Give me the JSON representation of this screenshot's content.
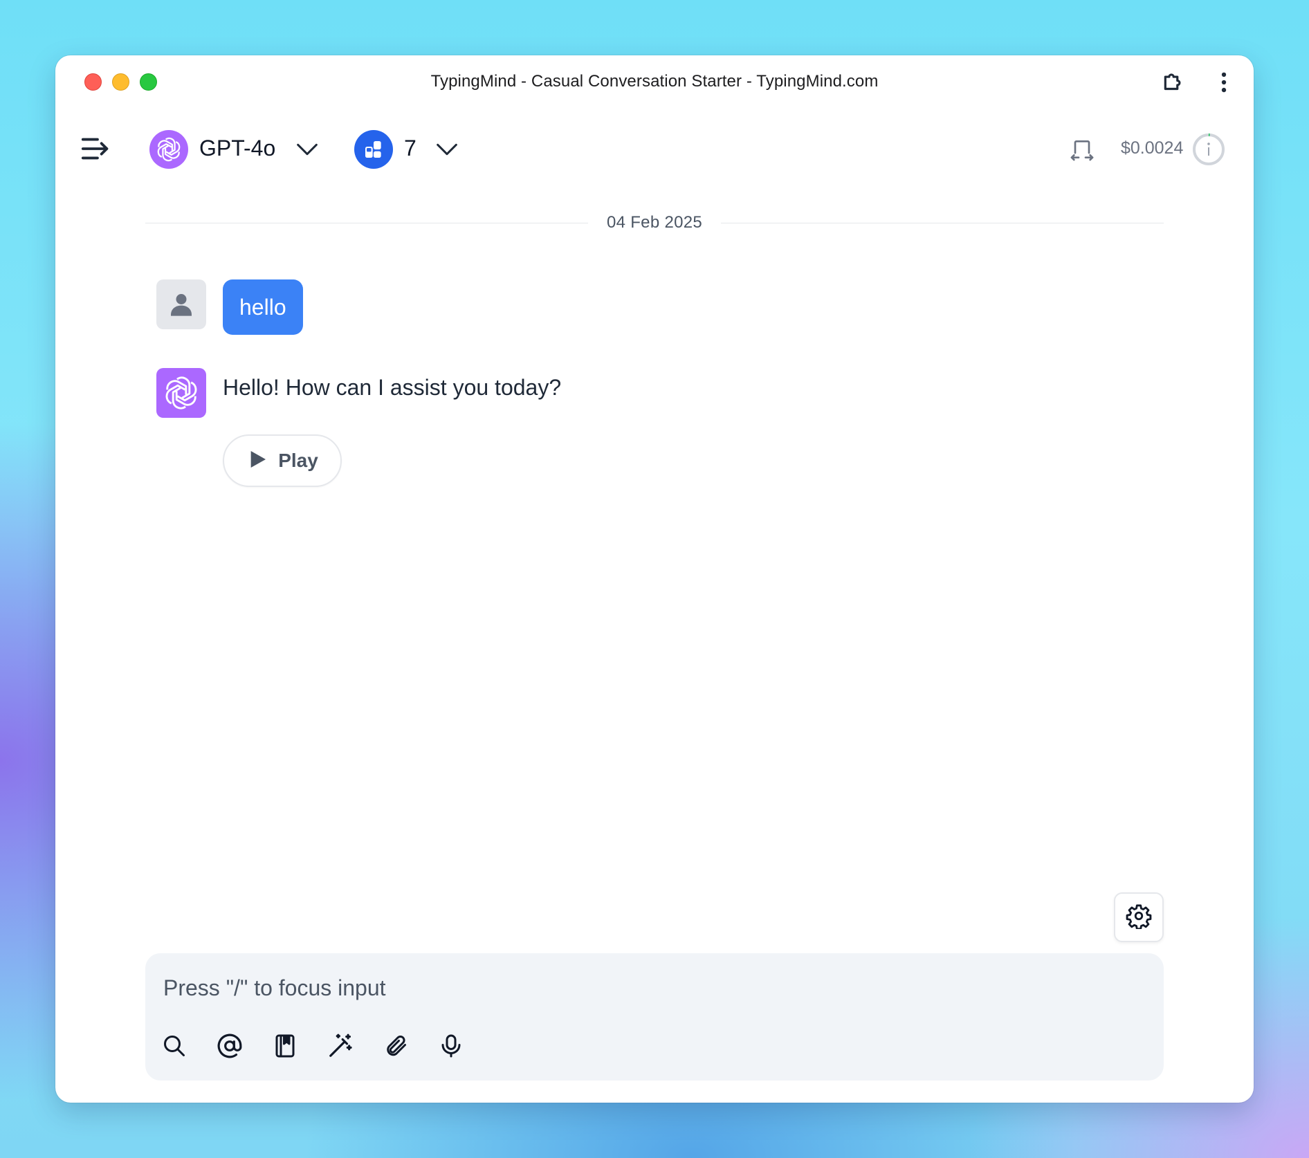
{
  "window": {
    "title": "TypingMind - Casual Conversation Starter - TypingMind.com"
  },
  "toolbar": {
    "model_name": "GPT-4o",
    "plugin_count": "7",
    "cost": "$0.0024"
  },
  "chat": {
    "date": "04 Feb 2025",
    "messages": [
      {
        "role": "user",
        "text": "hello"
      },
      {
        "role": "assistant",
        "text": "Hello! How can I assist you today?"
      }
    ],
    "play_label": "Play"
  },
  "composer": {
    "placeholder": "Press \"/\" to focus input",
    "tools": [
      "search-icon",
      "mention-icon",
      "prompt-library-icon",
      "magic-wand-icon",
      "attachment-icon",
      "microphone-icon"
    ]
  },
  "colors": {
    "accent_blue": "#3b82f6",
    "plugin_blue": "#2563eb",
    "model_purple": "#ab68ff"
  }
}
